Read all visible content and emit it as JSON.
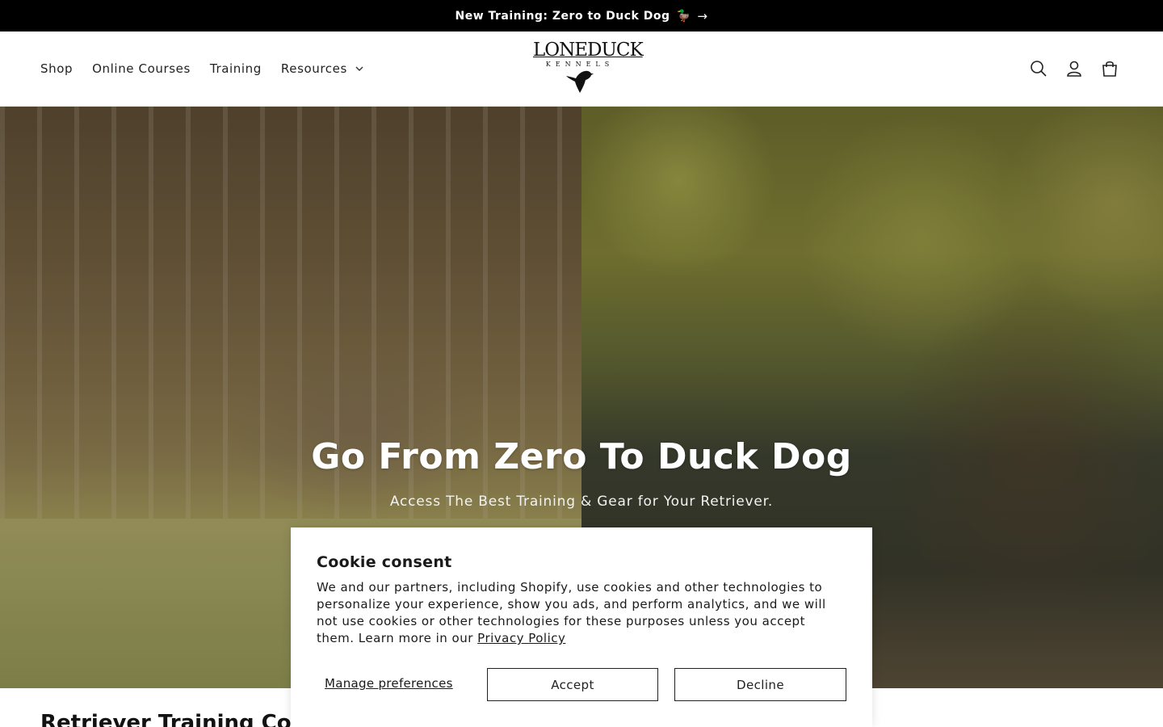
{
  "announcement": {
    "text": "New Training: Zero to Duck Dog",
    "emoji": "🦆",
    "arrow": "→"
  },
  "header": {
    "nav": [
      {
        "label": "Shop"
      },
      {
        "label": "Online Courses"
      },
      {
        "label": "Training"
      },
      {
        "label": "Resources",
        "has_dropdown": true
      }
    ],
    "logo": {
      "line1": "LONEDUCK",
      "line2": "KENNELS"
    },
    "icons": [
      "search-icon",
      "account-icon",
      "cart-icon"
    ]
  },
  "hero": {
    "title": "Go From Zero To Duck Dog",
    "subtitle": "Access The Best Training & Gear for Your Retriever."
  },
  "section": {
    "heading": "Retriever Training Co"
  },
  "cookie": {
    "title": "Cookie consent",
    "body": "We and our partners, including Shopify, use cookies and other technologies to personalize your experience, show you ads, and perform analytics, and we will not use cookies or other technologies for these purposes unless you accept them. Learn more in our",
    "link_label": "Privacy Policy",
    "manage_label": "Manage preferences",
    "accept_label": "Accept",
    "decline_label": "Decline"
  }
}
